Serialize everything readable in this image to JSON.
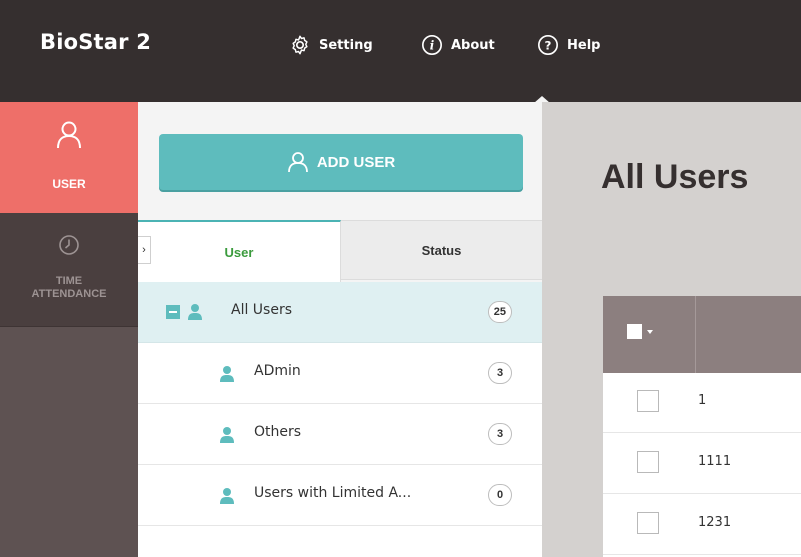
{
  "app": {
    "brand": "BioStar 2"
  },
  "topnav": {
    "setting": "Setting",
    "about": "About",
    "help": "Help"
  },
  "rail": {
    "user": "USER",
    "time_attendance_line1": "TIME",
    "time_attendance_line2": "ATTENDANCE"
  },
  "panel": {
    "add_user": "ADD USER",
    "tabs": {
      "user": "User",
      "status": "Status"
    },
    "groups": [
      {
        "name": "All Users",
        "count": "25"
      },
      {
        "name": "ADmin",
        "count": "3"
      },
      {
        "name": "Others",
        "count": "3"
      },
      {
        "name": "Users with Limited A...",
        "count": "0"
      }
    ]
  },
  "main": {
    "title": "All Users",
    "rows": [
      {
        "id": "1"
      },
      {
        "id": "1111"
      },
      {
        "id": "1231"
      }
    ]
  },
  "colors": {
    "topbar": "#352f2f",
    "rail_active": "#ee6f69",
    "accent": "#5ebcbd",
    "tab_active_text": "#3b9b3d"
  }
}
